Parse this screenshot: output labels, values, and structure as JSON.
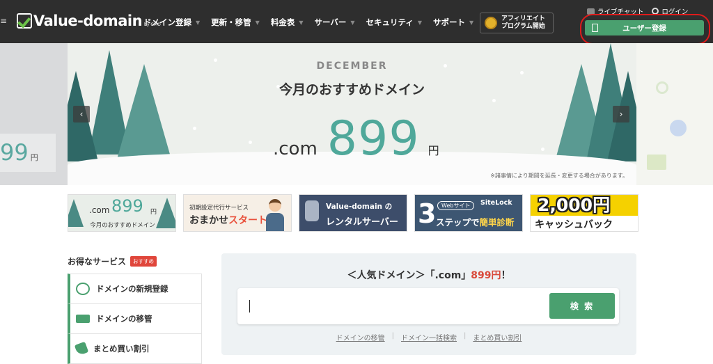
{
  "header": {
    "logo_text": "Value-domain",
    "logo_by": "by GMO",
    "nav": [
      {
        "label": "ドメイン登録"
      },
      {
        "label": "更新・移管"
      },
      {
        "label": "料金表"
      },
      {
        "label": "サーバー"
      },
      {
        "label": "セキュリティ"
      },
      {
        "label": "サポート"
      }
    ],
    "affiliate_line1": "アフィリエイト",
    "affiliate_line2": "プログラム開始",
    "live_chat": "ライブチャット",
    "login": "ログイン",
    "register": "ユーザー登録"
  },
  "hero": {
    "month": "DECEMBER",
    "title": "今月のおすすめドメイン",
    "tld": ".com",
    "price": "899",
    "yen": "円",
    "note": "※諸事情により期間を延長・変更する場合があります。",
    "left_peek_price": "99",
    "left_peek_yen": "円"
  },
  "banners": {
    "b1": {
      "tld": ".com",
      "price": "899",
      "yen": "円",
      "sub": "今月のおすすめドメイン"
    },
    "b2": {
      "line1": "初期設定代行サービス",
      "line2_a": "おまかせ",
      "line2_b": "スタート"
    },
    "b3": {
      "line1": "Value-domain の",
      "line2": "レンタルサーバー"
    },
    "b4": {
      "big": "3",
      "web": "Webサイト",
      "sitelock": "SiteLock",
      "line_a": "ステップで",
      "line_b": "簡単診断"
    },
    "b5": {
      "amount": "2,000円",
      "line2": "キャッシュバック"
    }
  },
  "services": {
    "title": "お得なサービス",
    "badge": "おすすめ",
    "items": [
      {
        "label": "ドメインの新規登録",
        "icon": "www-icon"
      },
      {
        "label": "ドメインの移管",
        "icon": "truck-icon"
      },
      {
        "label": "まとめ買い割引",
        "icon": "tag-icon"
      }
    ]
  },
  "search": {
    "title_a": "＜人気ドメイン＞「.com」",
    "title_price": "899円",
    "title_b": "！",
    "placeholder": "",
    "button": "検 索",
    "links": [
      "ドメインの移管",
      "ドメイン一括検索",
      "まとめ買い割引"
    ]
  },
  "colors": {
    "header_bg": "#2e2e2e",
    "accent_green": "#4aa06f",
    "price_teal": "#4fa89a",
    "alert_red": "#d94a3b",
    "highlight_oval": "#e01b1b"
  }
}
